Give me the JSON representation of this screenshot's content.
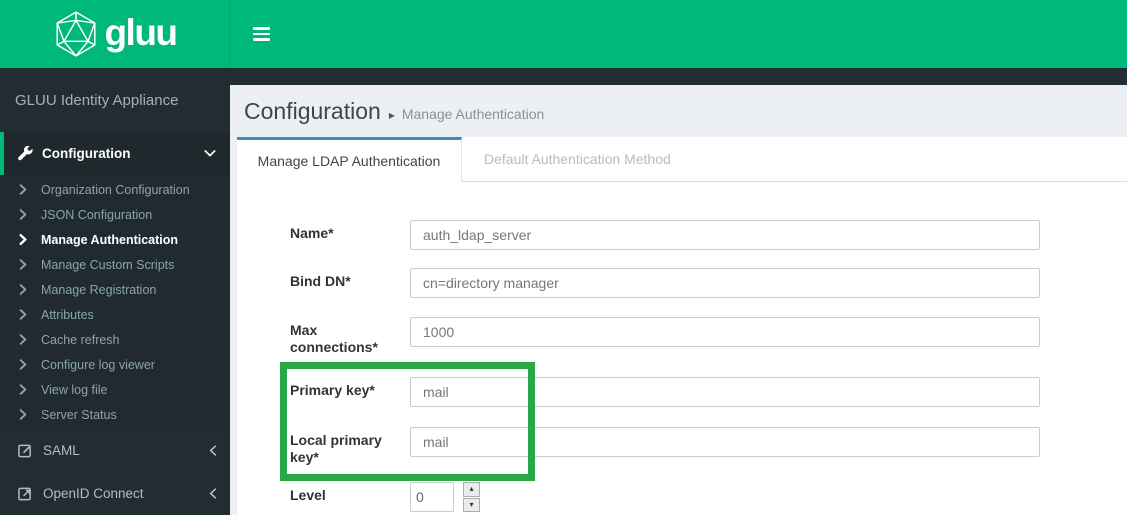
{
  "header": {
    "logo_text": "gluu"
  },
  "sidebar": {
    "title": "GLUU Identity Appliance",
    "config_label": "Configuration",
    "submenu": [
      "Organization Configuration",
      "JSON Configuration",
      "Manage Authentication",
      "Manage Custom Scripts",
      "Manage Registration",
      "Attributes",
      "Cache refresh",
      "Configure log viewer",
      "View log file",
      "Server Status"
    ],
    "active_item": "Manage Authentication",
    "saml_label": "SAML",
    "openid_label": "OpenID Connect"
  },
  "page": {
    "title": "Configuration",
    "separator": "▸",
    "breadcrumb": "Manage Authentication"
  },
  "tabs": {
    "active": "Manage LDAP Authentication",
    "inactive": "Default Authentication Method"
  },
  "form": {
    "fields": [
      {
        "label": "Name*",
        "value": "auth_ldap_server"
      },
      {
        "label": "Bind DN*",
        "value": "cn=directory manager"
      },
      {
        "label": "Max connections*",
        "value": "1000"
      },
      {
        "label": "Primary key*",
        "value": "mail",
        "highlighted": true
      },
      {
        "label": "Local primary key*",
        "value": "mail",
        "highlighted": true
      },
      {
        "label": "Level",
        "value": "0"
      }
    ],
    "spinner_up": "▴",
    "spinner_down": "▾"
  },
  "icons": {
    "menu": "hamburger-icon",
    "brand": "gluu-polyhedron-icon",
    "configuration": "wrench-icon",
    "submenu_item": "chevron-right-icon",
    "expanded": "chevron-down-icon",
    "collapsed": "chevron-left-icon",
    "saml": "edit-square-icon",
    "openid": "external-link-square-icon"
  },
  "colors": {
    "header_green": "#00b878",
    "highlight_green": "#28a745",
    "tab_accent_blue": "#3c8dbc",
    "sidebar_dark": "#222d32",
    "content_bg": "#ecf0f5"
  }
}
